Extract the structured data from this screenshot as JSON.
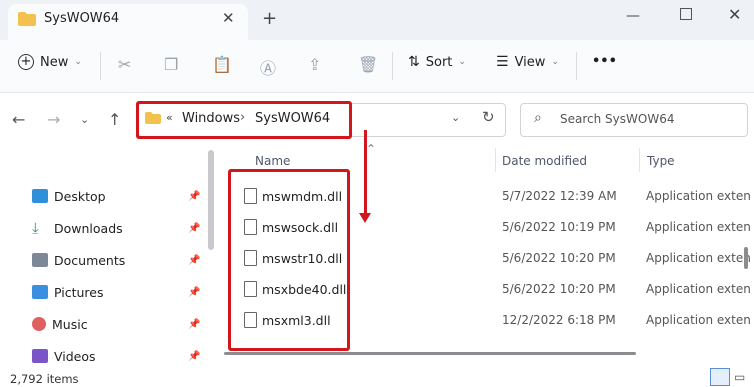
{
  "window": {
    "tab_title": "SysWOW64",
    "new_tab": "+",
    "close_tab": "✕",
    "minimize": "—",
    "close": "✕"
  },
  "toolbar": {
    "new_label": "New",
    "sort_label": "Sort",
    "view_label": "View",
    "more_label": "•••"
  },
  "address": {
    "overflow": "«",
    "segments": [
      "Windows",
      "SysWOW64"
    ],
    "separator": "›"
  },
  "search": {
    "placeholder": "Search SysWOW64"
  },
  "sidebar": {
    "items": [
      {
        "label": "Desktop",
        "icon": "desktop-icon",
        "color": "#2f8fd8"
      },
      {
        "label": "Downloads",
        "icon": "download-icon",
        "color": "#2e9e5b"
      },
      {
        "label": "Documents",
        "icon": "document-icon",
        "color": "#7c8896"
      },
      {
        "label": "Pictures",
        "icon": "pictures-icon",
        "color": "#3a8fe0"
      },
      {
        "label": "Music",
        "icon": "music-icon",
        "color": "#e06060"
      },
      {
        "label": "Videos",
        "icon": "videos-icon",
        "color": "#7b55c7"
      }
    ]
  },
  "columns": {
    "name": "Name",
    "date": "Date modified",
    "type": "Type"
  },
  "files": [
    {
      "name": "mswmdm.dll",
      "date": "5/7/2022 12:39 AM",
      "type": "Application exten"
    },
    {
      "name": "mswsock.dll",
      "date": "5/6/2022 10:19 PM",
      "type": "Application exten"
    },
    {
      "name": "mswstr10.dll",
      "date": "5/6/2022 10:20 PM",
      "type": "Application exten"
    },
    {
      "name": "msxbde40.dll",
      "date": "5/6/2022 10:20 PM",
      "type": "Application exten"
    },
    {
      "name": "msxml3.dll",
      "date": "12/2/2022 6:18 PM",
      "type": "Application exten"
    }
  ],
  "status": {
    "item_count": "2,792 items"
  },
  "colors": {
    "highlight": "#d3161c",
    "folder": "#f2c14e"
  }
}
